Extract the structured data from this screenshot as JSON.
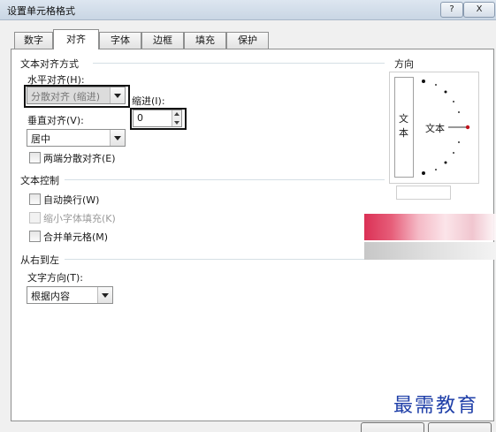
{
  "window": {
    "title": "设置单元格格式",
    "help_label": "?",
    "close_label": "X"
  },
  "tabs": [
    {
      "label": "数字"
    },
    {
      "label": "对齐"
    },
    {
      "label": "字体"
    },
    {
      "label": "边框"
    },
    {
      "label": "填充"
    },
    {
      "label": "保护"
    }
  ],
  "active_tab": "对齐",
  "alignment": {
    "section_title": "文本对齐方式",
    "horizontal_label": "水平对齐(H):",
    "horizontal_value": "分散对齐 (缩进)",
    "indent_label": "缩进(I):",
    "indent_value": "0",
    "vertical_label": "垂直对齐(V):",
    "vertical_value": "居中",
    "justify_distributed_label": "两端分散对齐(E)"
  },
  "text_control": {
    "section_title": "文本控制",
    "wrap_text_label": "自动换行(W)",
    "shrink_to_fit_label": "缩小字体填充(K)",
    "merge_cells_label": "合并单元格(M)"
  },
  "rtl": {
    "section_title": "从右到左",
    "direction_label": "文字方向(T):",
    "direction_value": "根据内容"
  },
  "orientation": {
    "section_title": "方向",
    "vertical_text_chars": [
      "文",
      "本"
    ],
    "dial_text": "文本"
  },
  "watermark": "最需教育",
  "icons": {
    "dropdown": "chevron-down-icon",
    "spinner": "spin-arrows-icon"
  }
}
